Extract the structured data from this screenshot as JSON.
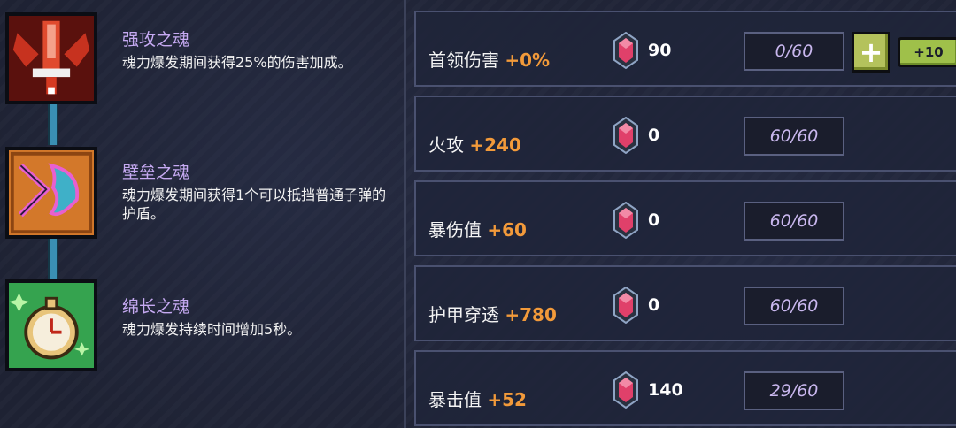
{
  "souls": [
    {
      "name": "强攻之魂",
      "desc": "魂力爆发期间获得25%的伤害加成。",
      "icon": "attack-soul-icon",
      "color": "#b3261e"
    },
    {
      "name": "壁垒之魂",
      "desc": "魂力爆发期间获得1个可以抵挡普通子弹的护盾。",
      "icon": "bulwark-soul-icon",
      "color": "#d9822b"
    },
    {
      "name": "绵长之魂",
      "desc": "魂力爆发持续时间增加5秒。",
      "icon": "duration-soul-icon",
      "color": "#2e9e4a"
    }
  ],
  "stats": [
    {
      "label": "首领伤害",
      "bonus": "+0%",
      "cost": "90",
      "level": "0/60"
    },
    {
      "label": "火攻",
      "bonus": "+240",
      "cost": "0",
      "level": "60/60"
    },
    {
      "label": "暴伤值",
      "bonus": "+60",
      "cost": "0",
      "level": "60/60"
    },
    {
      "label": "护甲穿透",
      "bonus": "+780",
      "cost": "0",
      "level": "60/60"
    },
    {
      "label": "暴击值",
      "bonus": "+52",
      "cost": "140",
      "level": "29/60"
    }
  ],
  "controls": {
    "plus_label": "+",
    "plus10_label": "+10"
  },
  "colors": {
    "bonus": "#f29a3a",
    "soul_name": "#c6aaf2",
    "upgrade_button": "#b4c25c"
  }
}
